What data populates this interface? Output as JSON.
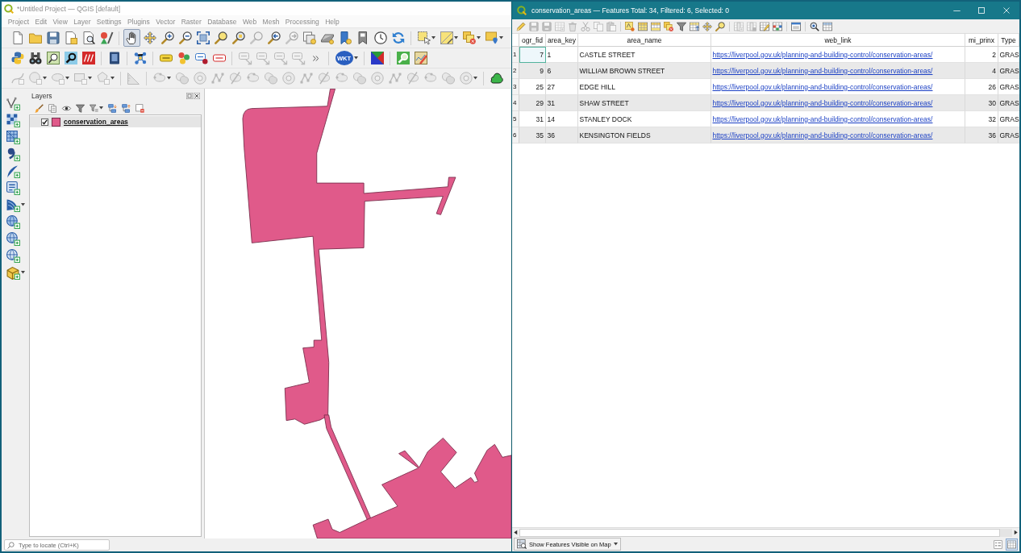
{
  "qgis_window": {
    "title": "*Untitled Project — QGIS [default]",
    "menu": [
      "Project",
      "Edit",
      "View",
      "Layer",
      "Settings",
      "Plugins",
      "Vector",
      "Raster",
      "Database",
      "Web",
      "Mesh",
      "Processing",
      "Help"
    ],
    "toolbars": [
      {
        "buttons": [
          {
            "disabled": false,
            "selected": false
          },
          {
            "disabled": false,
            "selected": false
          },
          {
            "disabled": false,
            "selected": false
          },
          {
            "disabled": false,
            "selected": false
          },
          {
            "disabled": false,
            "selected": false
          },
          {
            "disabled": false,
            "selected": false
          },
          {
            "disabled": false,
            "selected": true
          },
          {
            "disabled": false,
            "selected": false
          },
          {
            "disabled": false,
            "selected": false
          },
          {
            "disabled": false,
            "selected": false
          },
          {
            "disabled": false,
            "selected": false
          },
          {
            "disabled": false,
            "selected": false
          },
          {
            "disabled": false,
            "selected": false
          },
          {
            "disabled": true,
            "selected": false
          },
          {
            "disabled": false,
            "selected": false
          },
          {
            "disabled": true,
            "selected": false
          },
          {
            "disabled": false,
            "selected": false
          },
          {
            "disabled": false,
            "selected": false
          },
          {
            "disabled": false,
            "selected": false
          },
          {
            "disabled": false,
            "selected": false
          },
          {
            "disabled": false,
            "selected": false
          },
          {
            "disabled": false,
            "selected": false
          },
          {
            "disabled": false,
            "selected": false
          },
          {
            "disabled": false,
            "selected": false
          },
          {
            "disabled": false,
            "selected": false
          },
          {
            "disabled": false,
            "selected": false
          }
        ]
      },
      {
        "buttons": [
          {
            "disabled": false
          },
          {
            "disabled": false
          },
          {
            "disabled": false
          },
          {
            "disabled": false
          },
          {
            "disabled": false
          },
          {
            "disabled": false
          },
          {
            "disabled": false
          },
          {
            "disabled": false
          },
          {
            "disabled": false
          },
          {
            "disabled": false
          },
          {
            "disabled": false
          },
          {
            "disabled": true
          },
          {
            "disabled": true
          },
          {
            "disabled": true
          },
          {
            "disabled": true
          },
          {
            "disabled": false
          },
          {
            "disabled": false,
            "text": "WKT"
          },
          {
            "disabled": false
          },
          {
            "disabled": false
          },
          {
            "disabled": false
          }
        ]
      },
      {
        "buttons": [
          {
            "disabled": true
          },
          {
            "disabled": true
          },
          {
            "disabled": true
          },
          {
            "disabled": true
          },
          {
            "disabled": true
          },
          {
            "disabled": true
          },
          {
            "disabled": true
          },
          {
            "disabled": true
          },
          {
            "disabled": true
          },
          {
            "disabled": true
          },
          {
            "disabled": true
          },
          {
            "disabled": true
          },
          {
            "disabled": true
          },
          {
            "disabled": true
          },
          {
            "disabled": true
          },
          {
            "disabled": true
          },
          {
            "disabled": true
          },
          {
            "disabled": true
          },
          {
            "disabled": true
          },
          {
            "disabled": true
          },
          {
            "disabled": true
          },
          {
            "disabled": true
          },
          {
            "disabled": true
          },
          {
            "disabled": true
          },
          {
            "disabled": false
          }
        ]
      }
    ],
    "layers_panel": {
      "title": "Layers",
      "layers": [
        {
          "name": "conservation_areas",
          "checked": true,
          "selected": true,
          "color": "#e05a8a"
        }
      ]
    },
    "locator": {
      "placeholder": "Type to locate (Ctrl+K)"
    }
  },
  "attribute_table": {
    "title": "conservation_areas — Features Total: 34, Filtered: 6, Selected: 0",
    "toolbar": {
      "buttons": [
        {
          "disabled": false
        },
        {
          "disabled": true
        },
        {
          "disabled": true
        },
        {
          "disabled": true
        },
        {
          "disabled": true
        },
        {
          "disabled": true
        },
        {
          "disabled": true
        },
        {
          "disabled": true
        },
        {
          "disabled": false
        },
        {
          "disabled": false
        },
        {
          "disabled": false
        },
        {
          "disabled": false
        },
        {
          "disabled": false
        },
        {
          "disabled": false
        },
        {
          "disabled": false
        },
        {
          "disabled": false
        },
        {
          "disabled": true
        },
        {
          "disabled": true
        },
        {
          "disabled": false
        },
        {
          "disabled": false
        },
        {
          "disabled": false
        },
        {
          "disabled": false
        },
        {
          "disabled": false
        }
      ]
    },
    "columns": [
      {
        "name": "ogr_fid",
        "kind": "number"
      },
      {
        "name": "area_key",
        "kind": "text"
      },
      {
        "name": "area_name",
        "kind": "text"
      },
      {
        "name": "web_link",
        "kind": "link"
      },
      {
        "name": "mi_prinx",
        "kind": "number"
      },
      {
        "name": "Type",
        "kind": "text"
      }
    ],
    "rows": [
      {
        "number": "1",
        "current": true,
        "cells": [
          "7",
          "1",
          "CASTLE STREET",
          "https://liverpool.gov.uk/planning-and-building-control/conservation-areas/",
          "2",
          "GRAS"
        ]
      },
      {
        "number": "2",
        "current": false,
        "cells": [
          "9",
          "6",
          "WILLIAM BROWN STREET",
          "https://liverpool.gov.uk/planning-and-building-control/conservation-areas/",
          "4",
          "GRAS"
        ]
      },
      {
        "number": "3",
        "current": false,
        "cells": [
          "25",
          "27",
          "EDGE HILL",
          "https://liverpool.gov.uk/planning-and-building-control/conservation-areas/",
          "26",
          "GRAS"
        ]
      },
      {
        "number": "4",
        "current": false,
        "cells": [
          "29",
          "31",
          "SHAW STREET",
          "https://liverpool.gov.uk/planning-and-building-control/conservation-areas/",
          "30",
          "GRAS"
        ]
      },
      {
        "number": "5",
        "current": false,
        "cells": [
          "31",
          "14",
          "STANLEY DOCK",
          "https://liverpool.gov.uk/planning-and-building-control/conservation-areas/",
          "32",
          "GRAS"
        ]
      },
      {
        "number": "6",
        "current": false,
        "cells": [
          "35",
          "36",
          "KENSINGTON FIELDS",
          "https://liverpool.gov.uk/planning-and-building-control/conservation-areas/",
          "36",
          "GRAS"
        ]
      }
    ],
    "show_features_button": "Show Features Visible on Map",
    "view_buttons": [
      {
        "selected": false
      },
      {
        "selected": true
      }
    ]
  }
}
